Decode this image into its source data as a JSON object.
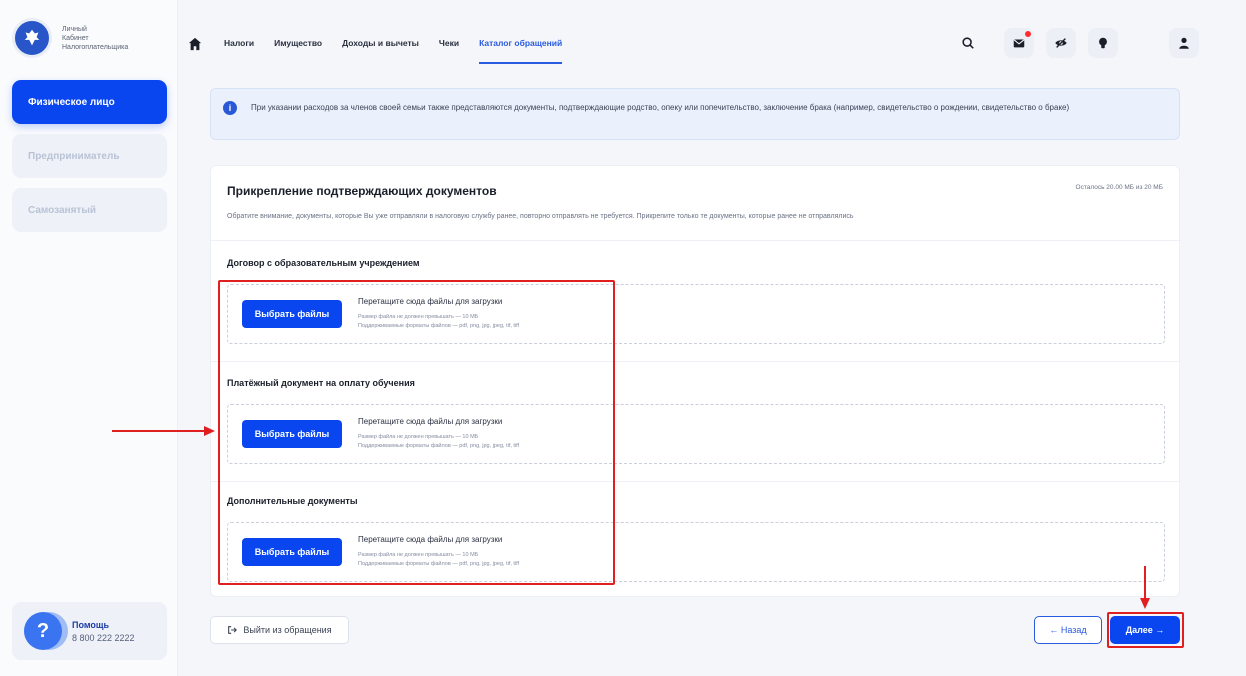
{
  "sidebar": {
    "logo_lines": [
      "Личный",
      "Кабинет",
      "Налогоплательщика"
    ],
    "items": [
      {
        "label": "Физическое лицо",
        "active": true
      },
      {
        "label": "Предприниматель",
        "active": false
      },
      {
        "label": "Самозанятый",
        "active": false
      }
    ],
    "help": {
      "title": "Помощь",
      "phone": "8 800 222 2222"
    }
  },
  "nav": {
    "items": [
      "Налоги",
      "Имущество",
      "Доходы и вычеты",
      "Чеки",
      "Каталог обращений"
    ],
    "active_index": 4
  },
  "top_icons": [
    "search-icon",
    "mail-icon",
    "eye-off-icon",
    "lightbulb-icon",
    "user-icon"
  ],
  "info_banner": {
    "text": "При указании расходов за членов своей семьи также представляются документы, подтверждающие родство, опеку или попечительство, заключение брака (например, свидетельство о рождении, свидетельство о браке)"
  },
  "card": {
    "title": "Прикрепление подтверждающих документов",
    "limit": "Осталось 20.00 МБ из 20 МБ",
    "note": "Обратите внимание, документы, которые Вы уже отправляли в налоговую службу ранее, повторно отправлять не требуется. Прикрепите только те документы, которые ранее не отправлялись",
    "sections": [
      {
        "title": "Договор с образовательным учреждением",
        "button": "Выбрать файлы",
        "drop_title": "Перетащите сюда файлы для загрузки",
        "size_hint": "Размер файла не должен превышать — 10 МБ",
        "formats_hint": "Поддерживаемые форматы файлов — pdf, png, jpg, jpeg, tif, tiff"
      },
      {
        "title": "Платёжный документ на оплату обучения",
        "button": "Выбрать файлы",
        "drop_title": "Перетащите сюда файлы для загрузки",
        "size_hint": "Размер файла не должен превышать — 10 МБ",
        "formats_hint": "Поддерживаемые форматы файлов — pdf, png, jpg, jpeg, tif, tiff"
      },
      {
        "title": "Дополнительные документы",
        "button": "Выбрать файлы",
        "drop_title": "Перетащите сюда файлы для загрузки",
        "size_hint": "Размер файла не должен превышать — 10 МБ",
        "formats_hint": "Поддерживаемые форматы файлов — pdf, png, jpg, jpeg, tif, tiff"
      }
    ]
  },
  "actions": {
    "exit": "Выйти из обращения",
    "back": "← Назад",
    "next": "Далее →"
  },
  "colors": {
    "primary": "#0a46f0",
    "annotation": "#e02020"
  }
}
